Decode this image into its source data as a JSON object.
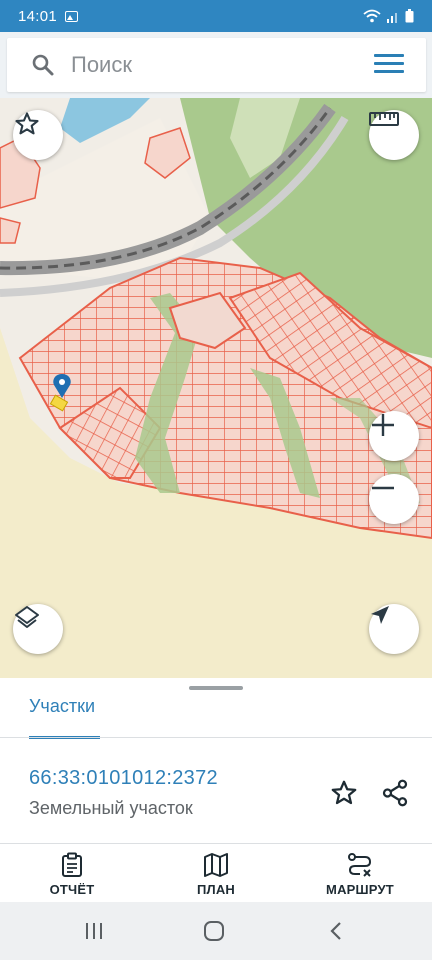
{
  "status_bar": {
    "time": "14:01",
    "icons": [
      "image-icon",
      "wifi-icon",
      "signal-icon",
      "battery-icon"
    ]
  },
  "search": {
    "placeholder": "Поиск",
    "icon": "search-icon",
    "menu_icon": "hamburger-menu-icon"
  },
  "map": {
    "controls": [
      "favorite-star-icon",
      "ruler-icon",
      "zoom-in-icon",
      "zoom-out-icon",
      "layers-icon",
      "navigate-arrow-icon"
    ],
    "marker_icon": "location-pin-icon",
    "colors": {
      "parcel_outline": "#e8604a",
      "forest": "#a9c98d",
      "field": "#f3eccb",
      "water": "#8cc6e0",
      "rail": "#6b6b6b"
    }
  },
  "panel": {
    "tab_label": "Участки",
    "parcel": {
      "cadastral_number": "66:33:0101012:2372",
      "type": "Земельный участок"
    },
    "actions": [
      "favorite-star-icon",
      "share-icon"
    ],
    "buttons": [
      {
        "label": "ОТЧЁТ",
        "icon": "report-icon"
      },
      {
        "label": "ПЛАН",
        "icon": "map-icon"
      },
      {
        "label": "МАРШРУТ",
        "icon": "route-icon"
      }
    ]
  },
  "nav_bar": {
    "icons": [
      "recent-apps-icon",
      "home-icon",
      "back-icon"
    ]
  },
  "colors": {
    "accent": "#2f80b8",
    "status_bar": "#2f86c1"
  }
}
